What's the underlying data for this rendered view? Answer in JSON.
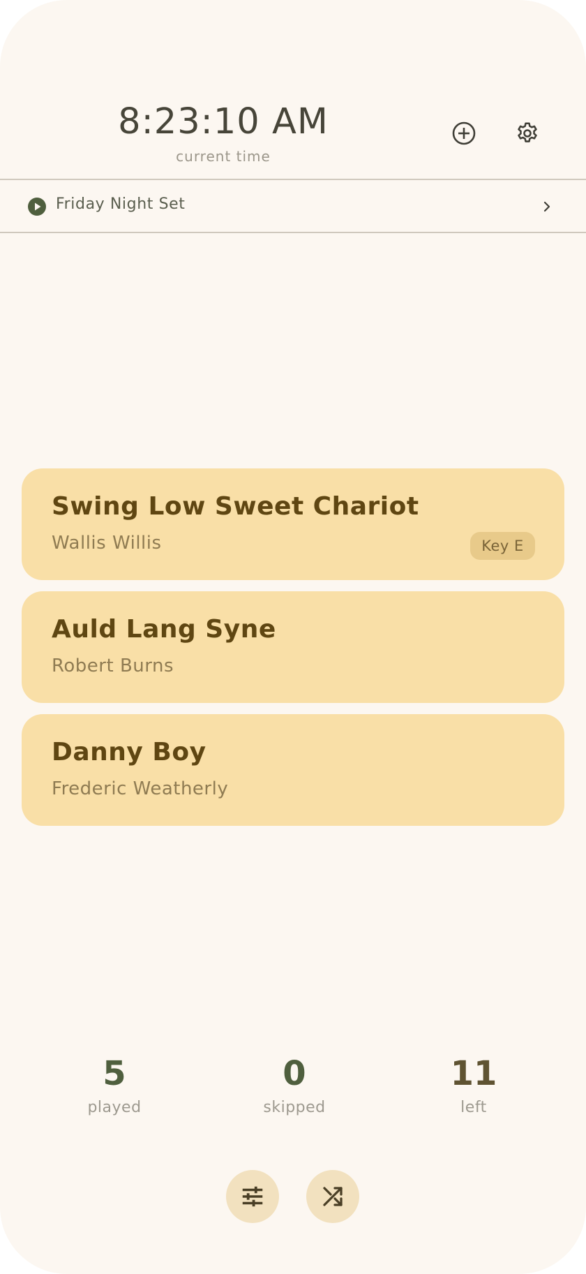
{
  "header": {
    "time": "8:23:10 AM",
    "time_caption": "current time"
  },
  "setlist": {
    "name": "Friday Night Set"
  },
  "songs": [
    {
      "title": "Swing Low Sweet Chariot",
      "author": "Wallis Willis",
      "key": "Key E"
    },
    {
      "title": "Auld Lang Syne",
      "author": "Robert Burns"
    },
    {
      "title": "Danny Boy",
      "author": "Frederic Weatherly"
    }
  ],
  "stats": {
    "played": {
      "value": "5",
      "label": "played"
    },
    "skipped": {
      "value": "0",
      "label": "skipped"
    },
    "left": {
      "value": "11",
      "label": "left"
    }
  },
  "icons": {
    "add": "add-circle-icon",
    "settings": "gear-icon",
    "play": "play-circle-icon",
    "chevron": "chevron-right-icon",
    "filters": "sliders-icon",
    "shuffle": "shuffle-icon"
  },
  "colors": {
    "background": "#fcf7f1",
    "card": "#f9dfa7",
    "card_title": "#5f4612",
    "stat_green": "#4f5f3e",
    "stat_olive": "#5f5332",
    "button": "#f2e1bf"
  }
}
